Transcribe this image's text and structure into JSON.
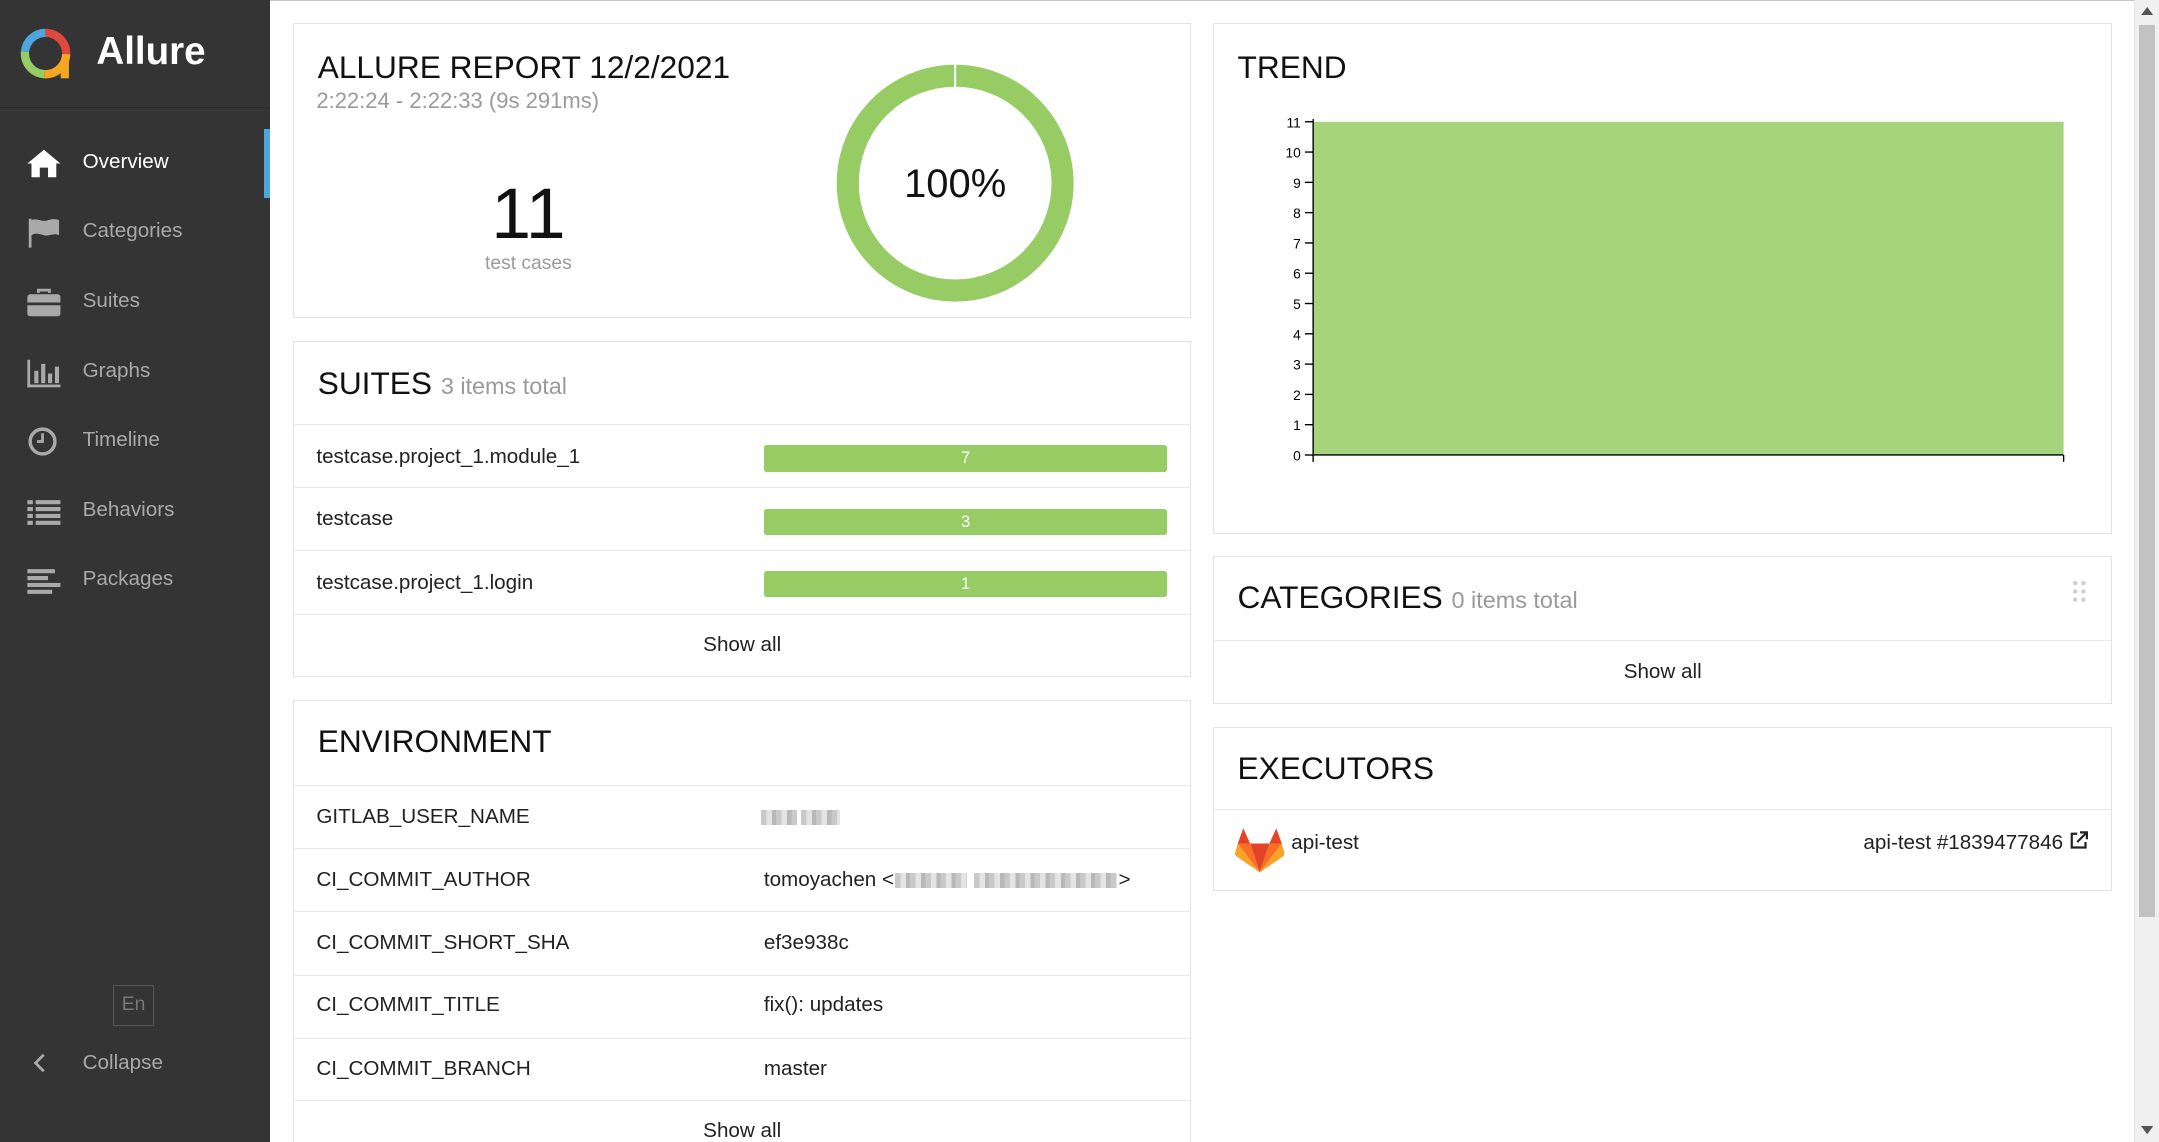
{
  "app": {
    "name": "Allure"
  },
  "sidebar": {
    "items": [
      {
        "label": "Overview",
        "icon": "home-icon",
        "active": true
      },
      {
        "label": "Categories",
        "icon": "flag-icon"
      },
      {
        "label": "Suites",
        "icon": "briefcase-icon"
      },
      {
        "label": "Graphs",
        "icon": "bar-chart-icon"
      },
      {
        "label": "Timeline",
        "icon": "clock-icon"
      },
      {
        "label": "Behaviors",
        "icon": "list-icon"
      },
      {
        "label": "Packages",
        "icon": "align-left-icon"
      }
    ],
    "language": "En",
    "collapse_label": "Collapse"
  },
  "summary": {
    "title": "ALLURE REPORT 12/2/2021",
    "time_range": "2:22:24 - 2:22:33 (9s 291ms)",
    "test_count": "11",
    "test_count_label": "test cases",
    "pass_percent_label": "100%",
    "pass_fraction": 1.0
  },
  "suites": {
    "title": "SUITES",
    "subtitle": "3 items total",
    "rows": [
      {
        "name": "testcase.project_1.module_1",
        "count": "7"
      },
      {
        "name": "testcase",
        "count": "3"
      },
      {
        "name": "testcase.project_1.login",
        "count": "1"
      }
    ],
    "show_all": "Show all"
  },
  "environment": {
    "title": "ENVIRONMENT",
    "rows": [
      {
        "key": "GITLAB_USER_NAME",
        "value": ""
      },
      {
        "key": "CI_COMMIT_AUTHOR",
        "value": "tomoyachen <",
        "value_end": ">"
      },
      {
        "key": "CI_COMMIT_SHORT_SHA",
        "value": "ef3e938c"
      },
      {
        "key": "CI_COMMIT_TITLE",
        "value": "fix(): updates"
      },
      {
        "key": "CI_COMMIT_BRANCH",
        "value": "master"
      }
    ],
    "show_all": "Show all"
  },
  "trend": {
    "title": "TREND"
  },
  "categories": {
    "title": "CATEGORIES",
    "subtitle": "0 items total",
    "show_all": "Show all"
  },
  "executors": {
    "title": "EXECUTORS",
    "name": "api-test",
    "build": "api-test #1839477846",
    "icon": "gitlab-icon"
  },
  "colors": {
    "sidebar": "#343434",
    "passed": "#97cc64",
    "active_indicator": "#4fa6dd"
  },
  "chart_data": {
    "type": "area",
    "title": "TREND",
    "x": [
      1,
      2
    ],
    "series": [
      {
        "values": [
          11,
          11
        ]
      }
    ],
    "ylim": [
      0,
      11
    ],
    "yticks": [
      0,
      1,
      2,
      3,
      4,
      5,
      6,
      7,
      8,
      9,
      10,
      11
    ],
    "grid": false,
    "color": "#a6d47c"
  }
}
